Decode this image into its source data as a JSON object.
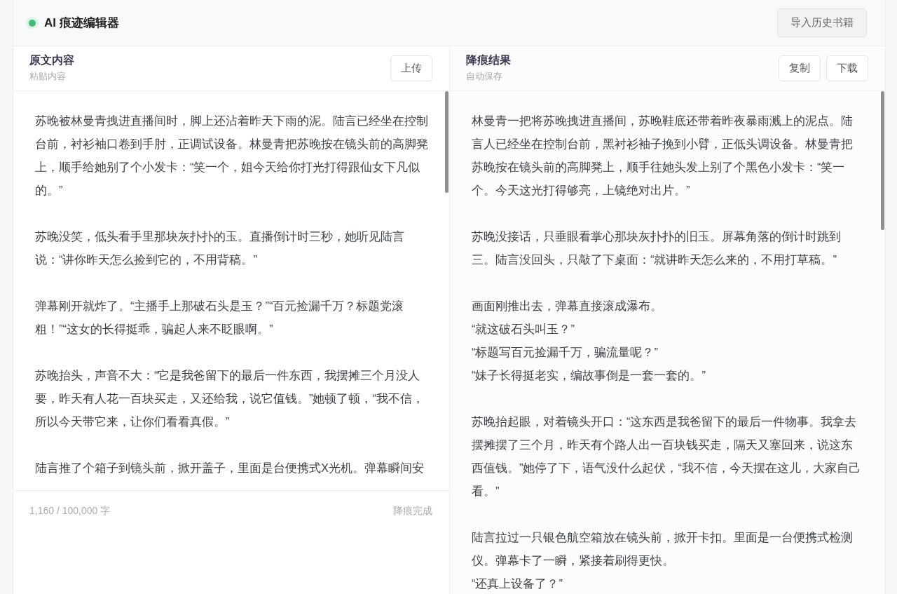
{
  "app": {
    "title": "AI 痕迹编辑器",
    "status_dot": {
      "color": "#3dbf77"
    },
    "import_button": "导入历史书籍"
  },
  "source": {
    "title": "原文内容",
    "subtitle": "粘贴内容",
    "buttons": [
      "上传"
    ],
    "paragraphs": [
      "苏晚被林曼青拽进直播间时，脚上还沾着昨天下雨的泥。陆言已经坐在控制台前，衬衫袖口卷到手肘，正调试设备。林曼青把苏晚按在镜头前的高脚凳上，顺手给她别了个小发卡：“笑一个，姐今天给你打光打得跟仙女下凡似的。”",
      "苏晚没笑，低头看手里那块灰扑扑的玉。直播倒计时三秒，她听见陆言说：“讲你昨天怎么捡到它的，不用背稿。”",
      "弹幕刚开就炸了。“主播手上那破石头是玉？”“百元捡漏千万？标题党滚粗！”“这女的长得挺乖，骗起人来不眨眼啊。”",
      "苏晚抬头，声音不大：“它是我爸留下的最后一件东西，我摆摊三个月没人要，昨天有人花一百块买走，又还给我，说它值钱。”她顿了顿，“我不信，所以今天带它来，让你们看看真假。”",
      "陆言推了个箱子到镜头前，掀开盖子，里面是台便携式X光机。弹幕瞬间安"
    ],
    "count": "1,160 / 100,000 字",
    "status": "降痕完成"
  },
  "result": {
    "title": "降痕结果",
    "subtitle": "自动保存",
    "buttons": [
      "复制",
      "下载"
    ],
    "blocks": [
      {
        "lines": [
          "林曼青一把将苏晚拽进直播间，苏晚鞋底还带着昨夜暴雨溅上的泥点。陆言人已经坐在控制台前，黑衬衫袖子挽到小臂，正低头调设备。林曼青把苏晚按在镜头前的高脚凳上，顺手往她头发上别了个黑色小发卡：“笑一个。今天这光打得够亮，上镜绝对出片。”"
        ]
      },
      {
        "lines": [
          "苏晚没接话，只垂眼看掌心那块灰扑扑的旧玉。屏幕角落的倒计时跳到三。陆言没回头，只敲了下桌面：“就讲昨天怎么来的，不用打草稿。”"
        ]
      },
      {
        "lines": [
          "画面刚推出去，弹幕直接滚成瀑布。",
          "“就这破石头叫玉？”",
          "“标题写百元捡漏千万，骗流量呢？”",
          "“妹子长得挺老实，编故事倒是一套一套的。”"
        ]
      },
      {
        "lines": [
          "苏晚抬起眼，对着镜头开口：“这东西是我爸留下的最后一件物事。我拿去摆摊摆了三个月，昨天有个路人出一百块钱买走，隔天又塞回来，说这东西值钱。”她停了下，语气没什么起伏，“我不信，今天摆在这儿，大家自己看。”"
        ]
      },
      {
        "lines": [
          "陆言拉过一只银色航空箱放在镜头前，掀开卡扣。里面是一台便携式检测仪。弹幕卡了一瞬，紧接着刷得更快。",
          "“还真上设备了？”"
        ]
      }
    ]
  }
}
